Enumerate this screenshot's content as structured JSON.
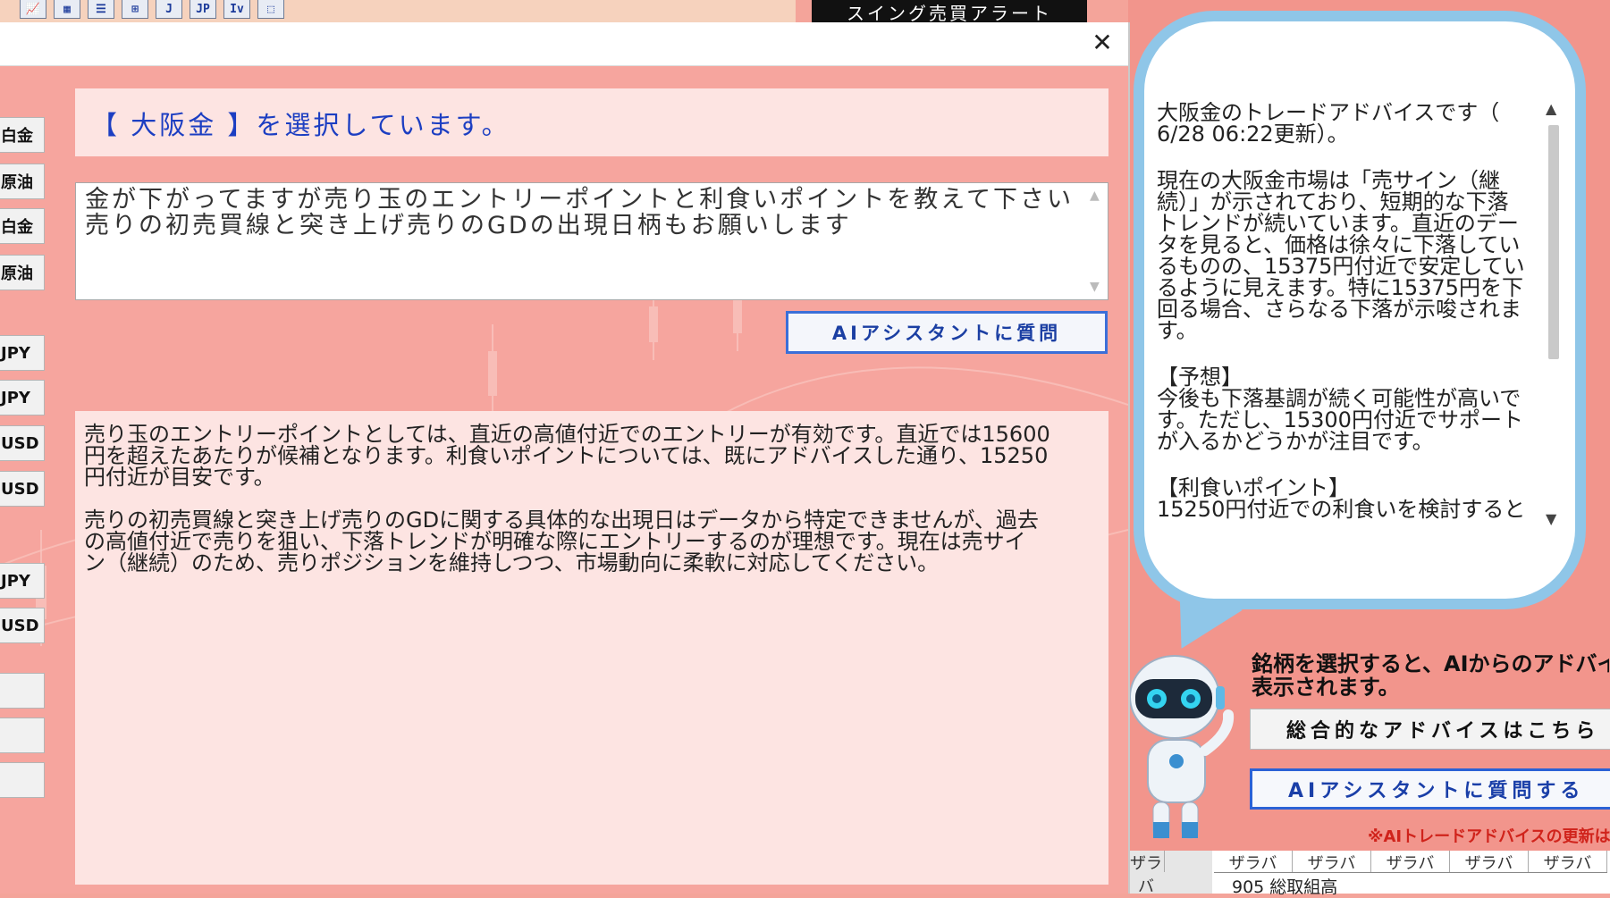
{
  "toolbar": {
    "icons": [
      {
        "name": "chart-icon",
        "glyph": "📈"
      },
      {
        "name": "table-icon",
        "glyph": "▦"
      },
      {
        "name": "list-icon",
        "glyph": "☰"
      },
      {
        "name": "grid-icon",
        "glyph": "⊞"
      },
      {
        "name": "j-icon",
        "glyph": "J"
      },
      {
        "name": "jp-icon",
        "glyph": "JP"
      },
      {
        "name": "iv-icon",
        "glyph": "Iv"
      },
      {
        "name": "box-icon",
        "glyph": "⬚"
      }
    ]
  },
  "background_app": {
    "alert_title": "スイング売買アラート",
    "advice": {
      "paragraphs": [
        "大阪金のトレードアドバイスです（\n6/28 06:22更新）。",
        "現在の大阪金市場は「売サイン（継\n続）」が示されており、短期的な下落\nトレンドが続いています。直近のデー\nタを見ると、価格は徐々に下落してい\nるものの、15375円付近で安定してい\nるように見えます。特に15375円を下\n回る場合、さらなる下落が示唆されま\nす。",
        "【予想】\n今後も下落基調が続く可能性が高いで\nす。ただし、15300円付近でサポート\nが入るかどうかが注目です。",
        "【利食いポイント】\n15250円付近での利食いを検討すると"
      ]
    },
    "robot_caption": "銘柄を選択すると、AIからのアドバイスが\n表示されます。",
    "overall_advice_button": "総合的なアドバイスはこちら",
    "ask_ai_button": "AIアシスタントに質問する",
    "note": "※AIトレードアドバイスの更新は、毎",
    "grid": {
      "left_header": "ザラバ",
      "headers": [
        "ザラバ",
        "ザラバ",
        "ザラバ",
        "ザラバ",
        "ザラバ"
      ],
      "row_text": "905 総取組高"
    }
  },
  "dialog": {
    "close_glyph": "✕",
    "left_buttons": [
      "白金",
      "原油",
      "白金",
      "原油",
      "JPY",
      "JPY",
      "USD",
      "USD",
      "JPY",
      "USD",
      "",
      "",
      ""
    ],
    "selection_banner": "【 大阪金 】を選択しています。",
    "question": "金が下がってますが売り玉のエントリーポイントと利食いポイントを教えて下さい　売りの初売買線と突き上げ売りのGDの出現日柄もお願いします",
    "ask_button": "AIアシスタントに質問",
    "answer_paragraphs": [
      "売り玉のエントリーポイントとしては、直近の高値付近でのエントリーが有効です。直近では15600\n円を超えたあたりが候補となります。利食いポイントについては、既にアドバイスした通り、15250\n円付近が目安です。",
      "売りの初売買線と突き上げ売りのGDに関する具体的な出現日はデータから特定できませんが、過去\nの高値付近で売りを狙い、下落トレンドが明確な際にエントリーするのが理想です。現在は売サイ\nン（継続）のため、売りポジションを維持しつつ、市場動向に柔軟に対応してください。"
    ]
  }
}
